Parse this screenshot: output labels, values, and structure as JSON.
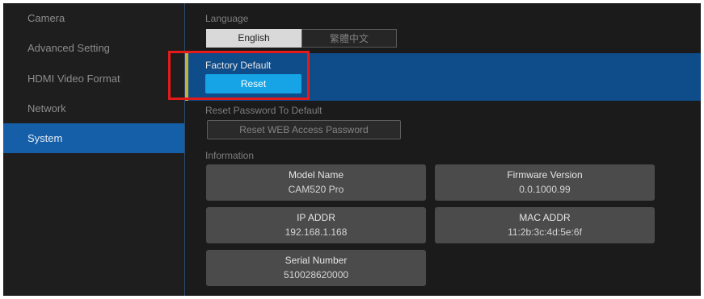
{
  "sidebar": {
    "items": [
      {
        "label": "Camera",
        "active": false
      },
      {
        "label": "Advanced Setting",
        "active": false
      },
      {
        "label": "HDMI Video Format",
        "active": false
      },
      {
        "label": "Network",
        "active": false
      },
      {
        "label": "System",
        "active": true
      }
    ]
  },
  "language": {
    "label": "Language",
    "options": [
      "English",
      "繁體中文"
    ],
    "selected": "English"
  },
  "factory_default": {
    "label": "Factory Default",
    "button_label": "Reset"
  },
  "reset_password": {
    "label": "Reset Password To Default",
    "button_label": "Reset WEB Access Password"
  },
  "information": {
    "label": "Information",
    "cards": [
      {
        "title": "Model Name",
        "value": "CAM520 Pro"
      },
      {
        "title": "Firmware Version",
        "value": "0.0.1000.99"
      },
      {
        "title": "IP ADDR",
        "value": "192.168.1.168"
      },
      {
        "title": "MAC ADDR",
        "value": "11:2b:3c:4d:5e:6f"
      },
      {
        "title": "Serial Number",
        "value": "510028620000"
      }
    ]
  },
  "colors": {
    "background": "#1b1b1b",
    "active_sidebar": "#155fa8",
    "highlight_band": "#0f4c8a",
    "accent_bar": "#c4b13a",
    "primary_button": "#16a4e6",
    "annotation_box": "#e51a1a",
    "card_background": "#4b4b4b"
  }
}
